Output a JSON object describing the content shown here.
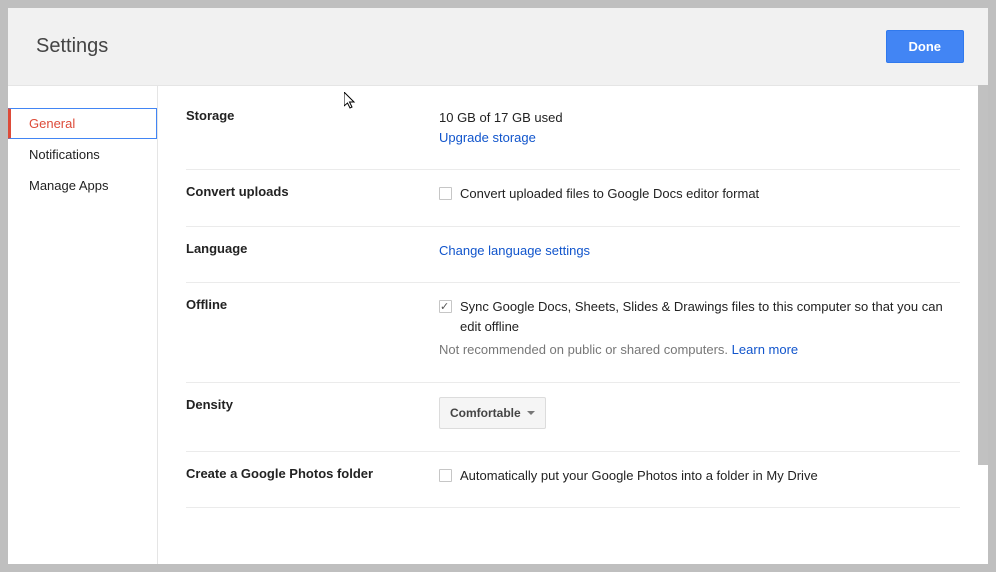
{
  "header": {
    "title": "Settings",
    "done_label": "Done"
  },
  "sidebar": {
    "items": [
      {
        "label": "General",
        "active": true
      },
      {
        "label": "Notifications",
        "active": false
      },
      {
        "label": "Manage Apps",
        "active": false
      }
    ]
  },
  "sections": {
    "storage": {
      "label": "Storage",
      "usage": "10 GB of 17 GB used",
      "upgrade_link": "Upgrade storage"
    },
    "convert": {
      "label": "Convert uploads",
      "checkbox_label": "Convert uploaded files to Google Docs editor format",
      "checked": false
    },
    "language": {
      "label": "Language",
      "link": "Change language settings"
    },
    "offline": {
      "label": "Offline",
      "checkbox_label": "Sync Google Docs, Sheets, Slides & Drawings files to this computer so that you can edit offline",
      "checked": true,
      "note": "Not recommended on public or shared computers.",
      "learn_more": "Learn more"
    },
    "density": {
      "label": "Density",
      "selected": "Comfortable"
    },
    "photos": {
      "label": "Create a Google Photos folder",
      "checkbox_label": "Automatically put your Google Photos into a folder in My Drive",
      "checked": false
    }
  }
}
